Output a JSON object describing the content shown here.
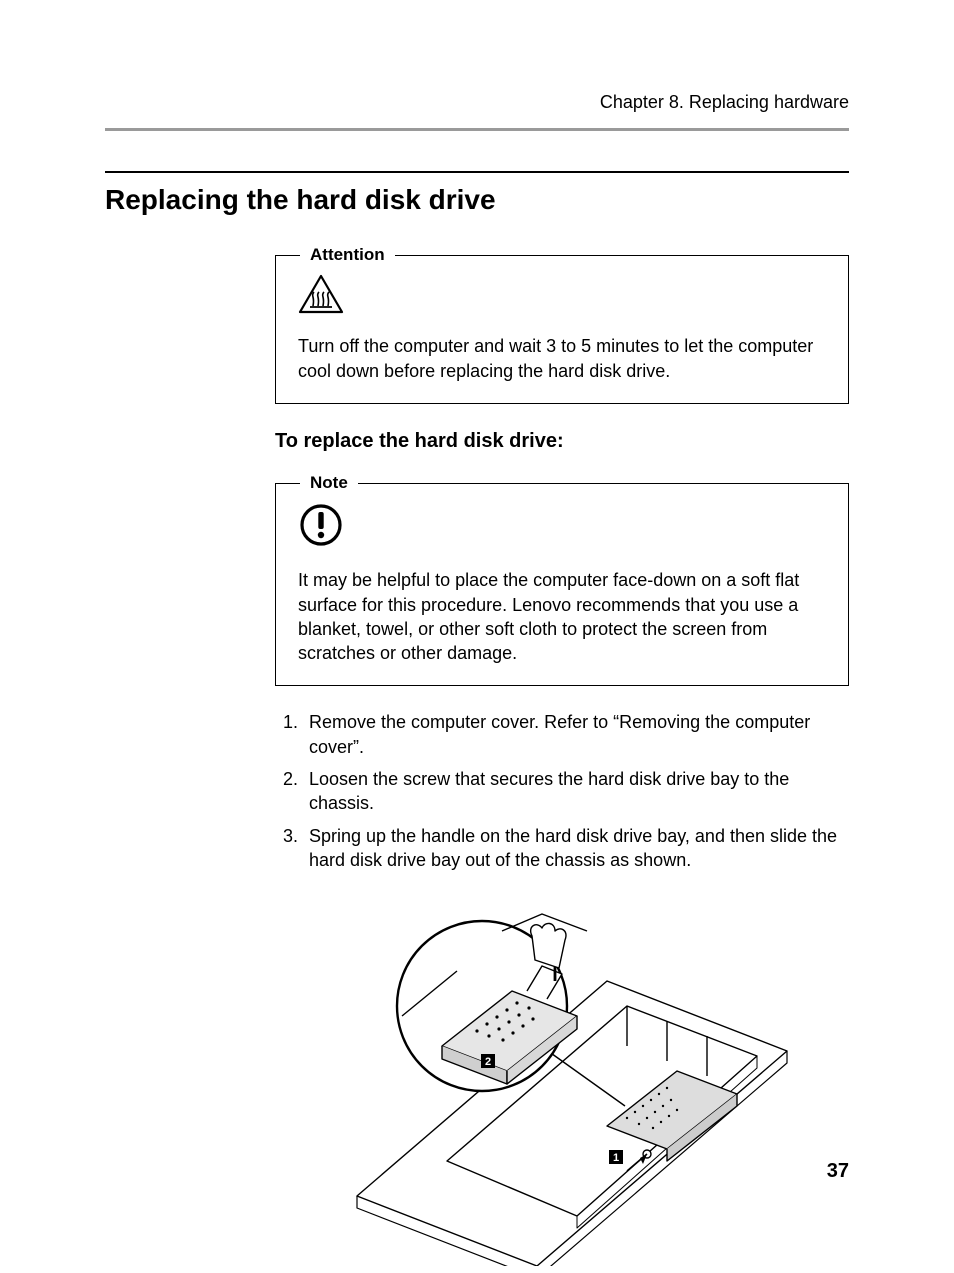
{
  "header": {
    "running": "Chapter 8. Replacing hardware"
  },
  "section": {
    "title": "Replacing the hard disk drive"
  },
  "attention_box": {
    "legend": "Attention",
    "icon": "heat-warning-icon",
    "text": "Turn off the computer and wait 3 to 5 minutes to let the computer cool down before replacing the hard disk drive."
  },
  "subheading": "To replace the hard disk drive:",
  "note_box": {
    "legend": "Note",
    "icon": "exclamation-icon",
    "text": "It may be helpful to place the computer face-down on a soft flat surface for this procedure. Lenovo recommends that you use a blanket, towel, or other soft cloth to protect the screen from scratches or other damage."
  },
  "steps": [
    "Remove the computer cover. Refer to “Removing the computer cover”.",
    "Loosen the screw that secures the hard disk drive bay to the chassis.",
    "Spring up the handle on the hard disk drive bay, and then slide the hard disk drive bay out of the chassis as shown."
  ],
  "figure": {
    "callouts": [
      "1",
      "2"
    ]
  },
  "page_number": "37"
}
